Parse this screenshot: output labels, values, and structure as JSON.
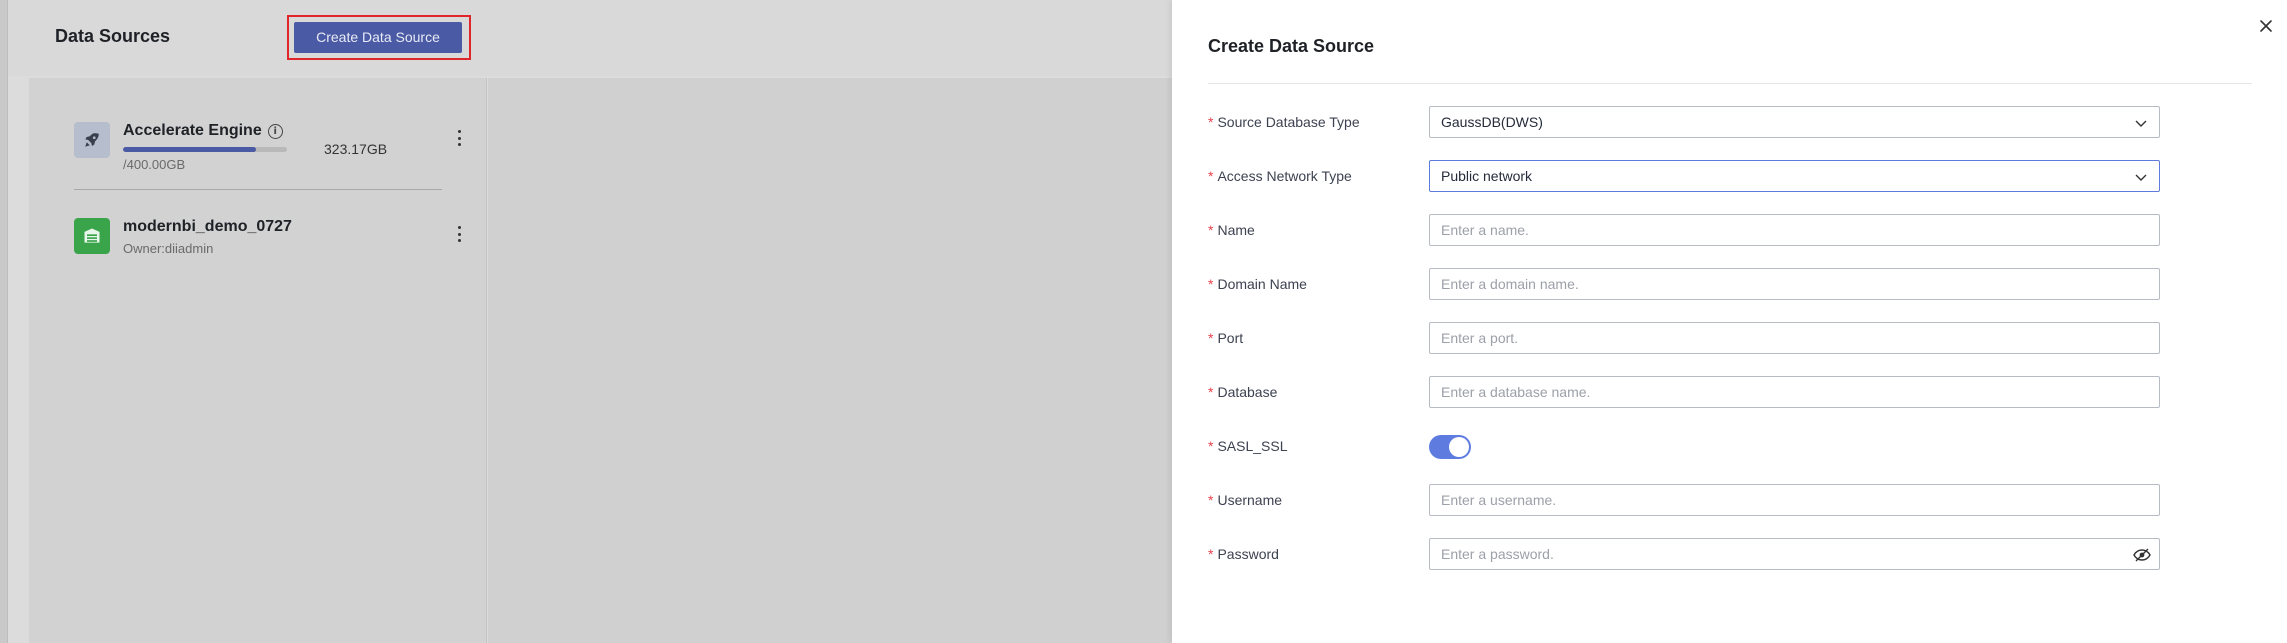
{
  "page": {
    "title": "Data Sources",
    "create_button": "Create Data Source"
  },
  "data_sources": [
    {
      "name": "Accelerate Engine",
      "icon": "rocket-icon",
      "used": "323.17GB",
      "total": "/400.00GB",
      "usage_fraction": 0.81
    },
    {
      "name": "modernbi_demo_0727",
      "icon": "database-icon",
      "owner": "Owner:diiadmin"
    }
  ],
  "drawer": {
    "title": "Create Data Source",
    "fields": {
      "source_db_type": {
        "label": "Source Database Type",
        "value": "GaussDB(DWS)"
      },
      "network_type": {
        "label": "Access Network Type",
        "value": "Public network"
      },
      "name": {
        "label": "Name",
        "placeholder": "Enter a name."
      },
      "domain": {
        "label": "Domain Name",
        "placeholder": "Enter a domain name."
      },
      "port": {
        "label": "Port",
        "placeholder": "Enter a port."
      },
      "database": {
        "label": "Database",
        "placeholder": "Enter a database name."
      },
      "sasl_ssl": {
        "label": "SASL_SSL",
        "enabled": true
      },
      "username": {
        "label": "Username",
        "placeholder": "Enter a username."
      },
      "password": {
        "label": "Password",
        "placeholder": "Enter a password."
      }
    },
    "required_mark": "*"
  },
  "colors": {
    "primary": "#5e7ce0",
    "button_dimmed": "#4a5aa4",
    "required": "#e5424c",
    "highlight_outline": "#e0262a",
    "db_icon_bg": "#3aa44b"
  }
}
